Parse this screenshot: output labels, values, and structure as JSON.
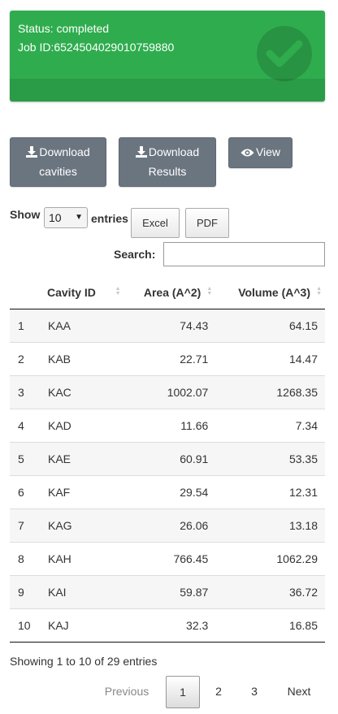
{
  "status": {
    "status_line": "Status: completed",
    "job_line": "Job ID:6524504029010759880",
    "icon": "check-circle-icon",
    "color": "#2fad4e"
  },
  "actions": {
    "download_cavities": [
      "Download",
      "cavities"
    ],
    "download_results": [
      "Download",
      "Results"
    ],
    "view": "View"
  },
  "table_controls": {
    "show_label": "Show",
    "page_length": "10",
    "entries_label": "entries",
    "excel_label": "Excel",
    "pdf_label": "PDF",
    "search_label": "Search:",
    "search_value": ""
  },
  "table": {
    "columns": [
      "",
      "Cavity ID",
      "Area (A^2)",
      "Volume (A^3)"
    ],
    "rows": [
      [
        "1",
        "KAA",
        "74.43",
        "64.15"
      ],
      [
        "2",
        "KAB",
        "22.71",
        "14.47"
      ],
      [
        "3",
        "KAC",
        "1002.07",
        "1268.35"
      ],
      [
        "4",
        "KAD",
        "11.66",
        "7.34"
      ],
      [
        "5",
        "KAE",
        "60.91",
        "53.35"
      ],
      [
        "6",
        "KAF",
        "29.54",
        "12.31"
      ],
      [
        "7",
        "KAG",
        "26.06",
        "13.18"
      ],
      [
        "8",
        "KAH",
        "766.45",
        "1062.29"
      ],
      [
        "9",
        "KAI",
        "59.87",
        "36.72"
      ],
      [
        "10",
        "KAJ",
        "32.3",
        "16.85"
      ]
    ]
  },
  "footer": {
    "info": "Showing 1 to 10 of 29 entries",
    "previous": "Previous",
    "pages": [
      "1",
      "2",
      "3"
    ],
    "current_page": "1",
    "next": "Next"
  }
}
